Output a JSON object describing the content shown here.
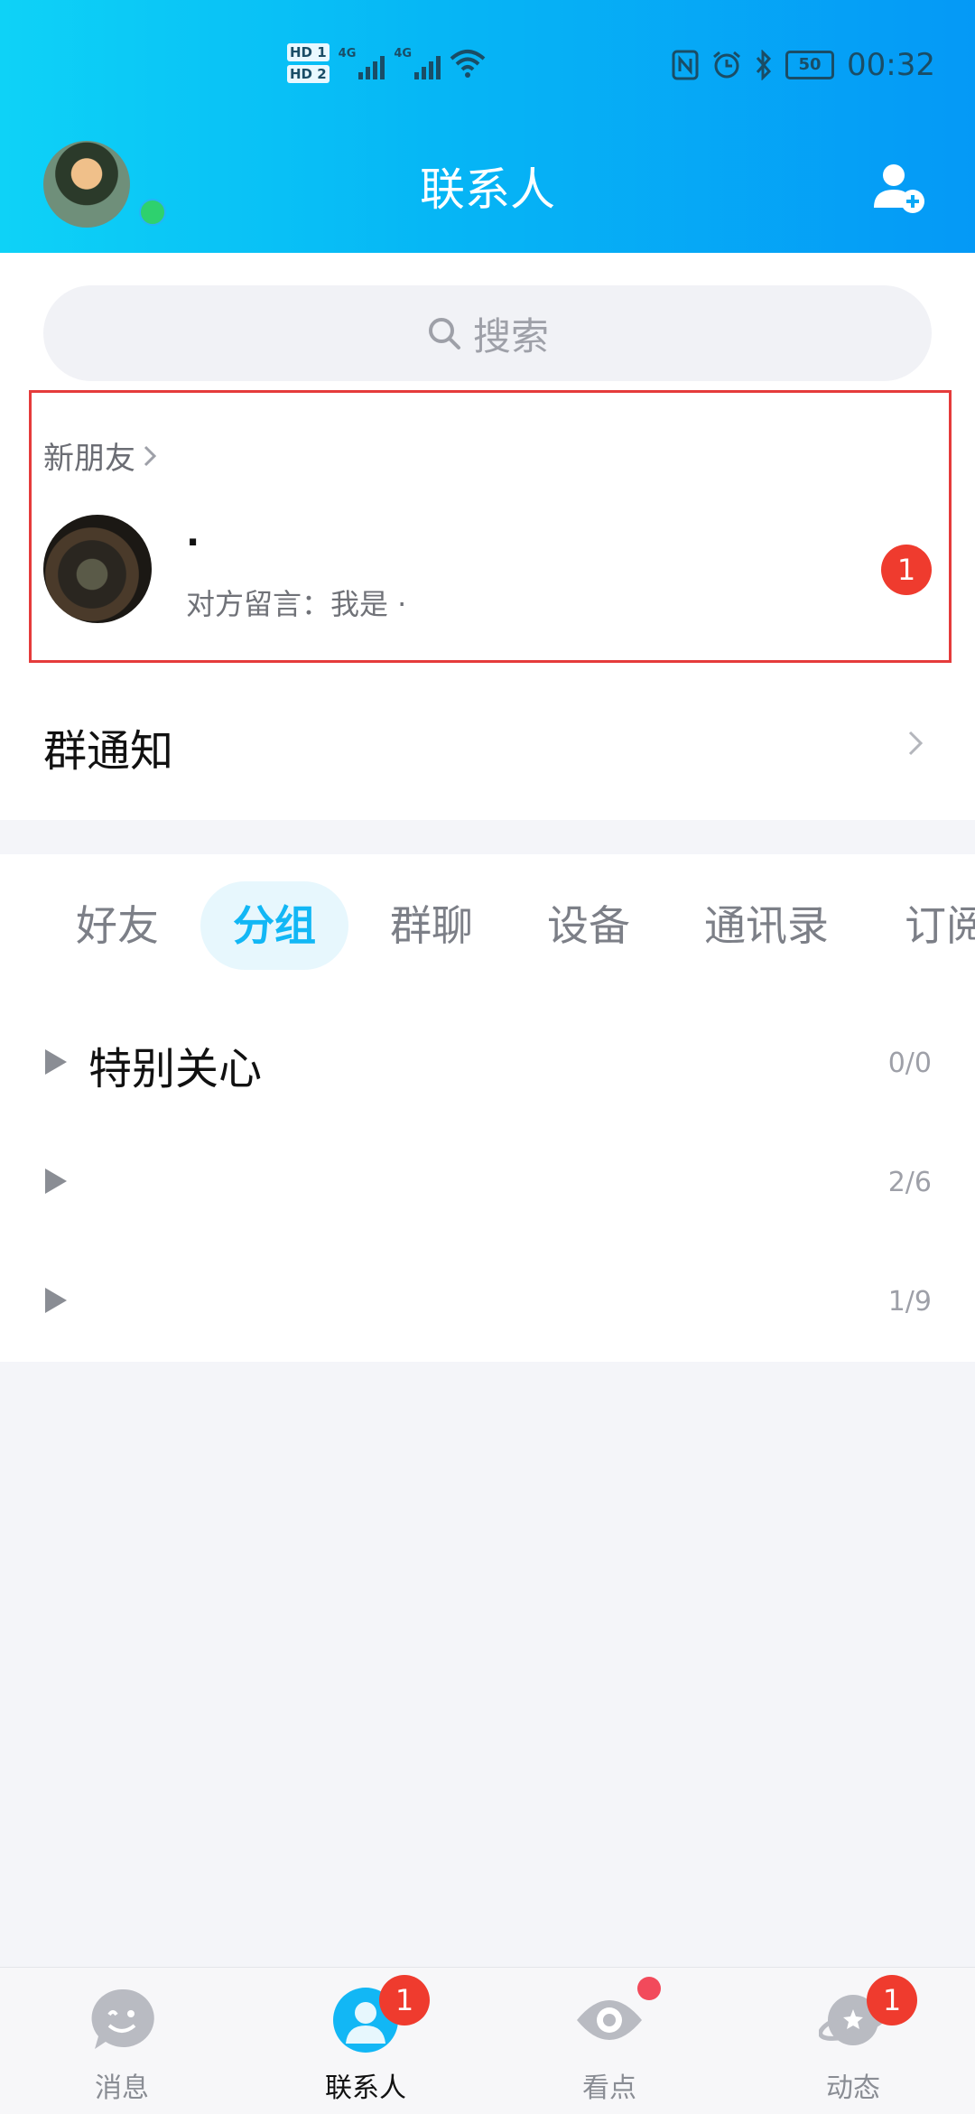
{
  "status_bar": {
    "sim1": "HD 1",
    "sim2": "HD 2",
    "net1": "4G",
    "net2": "4G",
    "battery": "50",
    "time": "00:32"
  },
  "header": {
    "title": "联系人"
  },
  "search": {
    "placeholder": "搜索"
  },
  "new_friends": {
    "label": "新朋友",
    "request": {
      "name": "·",
      "message": "对方留言：我是 ·",
      "badge": "1"
    }
  },
  "group_notice": {
    "label": "群通知"
  },
  "tabs": [
    {
      "label": "好友",
      "active": false
    },
    {
      "label": "分组",
      "active": true
    },
    {
      "label": "群聊",
      "active": false
    },
    {
      "label": "设备",
      "active": false
    },
    {
      "label": "通讯录",
      "active": false
    },
    {
      "label": "订阅",
      "active": false
    }
  ],
  "groups": [
    {
      "name": "特别关心",
      "count": "0/0"
    },
    {
      "name": "",
      "count": "2/6"
    },
    {
      "name": "",
      "count": "1/9"
    }
  ],
  "bottom_nav": [
    {
      "label": "消息",
      "icon": "chat-icon",
      "badge": ""
    },
    {
      "label": "联系人",
      "icon": "contacts-icon",
      "badge": "1"
    },
    {
      "label": "看点",
      "icon": "eye-icon",
      "badge": ""
    },
    {
      "label": "动态",
      "icon": "planet-icon",
      "badge": "1"
    }
  ],
  "colors": {
    "accent": "#12b7f5",
    "badge": "#ef3b2e",
    "online": "#2ed16e"
  }
}
